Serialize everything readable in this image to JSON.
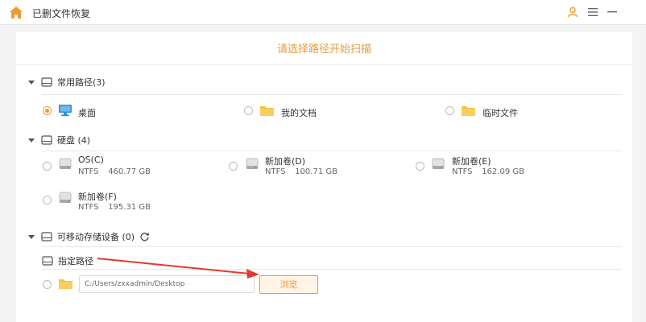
{
  "app": {
    "title": "已删文件恢复"
  },
  "header": {
    "heading": "请选择路径开始扫描"
  },
  "sections": {
    "common": {
      "label": "常用路径(3)"
    },
    "disk": {
      "label": "硬盘 (4)"
    },
    "removable": {
      "label": "可移动存储设备 (0)"
    },
    "custom": {
      "label": "指定路径"
    }
  },
  "common_items": [
    {
      "label": "桌面",
      "selected": true
    },
    {
      "label": "我的文档",
      "selected": false
    },
    {
      "label": "临时文件",
      "selected": false
    }
  ],
  "drives": [
    {
      "name": "OS(C)",
      "fs": "NTFS",
      "size": "460.77 GB"
    },
    {
      "name": "新加卷(D)",
      "fs": "NTFS",
      "size": "100.71 GB"
    },
    {
      "name": "新加卷(E)",
      "fs": "NTFS",
      "size": "162.09 GB"
    },
    {
      "name": "新加卷(F)",
      "fs": "NTFS",
      "size": "195.31 GB"
    }
  ],
  "custom_path": {
    "value": "C:/Users/zxxadmin/Desktop",
    "browse_label": "浏览"
  },
  "colors": {
    "accent": "#e89a3c",
    "folder": "#f5c242",
    "monitor": "#2f8fd8",
    "arrow": "#e03a2e"
  },
  "icons": [
    "home-icon",
    "user-icon",
    "menu-icon",
    "minimize-icon",
    "refresh-icon",
    "desktop-icon",
    "folder-icon",
    "drive-icon"
  ]
}
